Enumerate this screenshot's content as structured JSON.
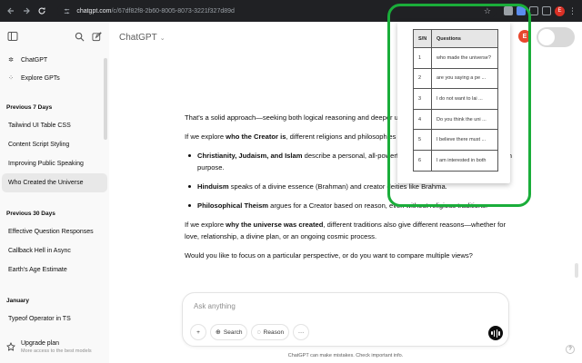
{
  "browser": {
    "url_host": "chatgpt.com",
    "url_path": "/c/67df82f8-2b60-8005-8073-3221f327d89d",
    "profile_letter": "E"
  },
  "sidebar": {
    "top_items": [
      {
        "label": "ChatGPT",
        "icon": "chatgpt-logo-icon"
      },
      {
        "label": "Explore GPTs",
        "icon": "grid-icon"
      }
    ],
    "sections": [
      {
        "title": "Previous 7 Days",
        "items": [
          "Tailwind UI Table CSS",
          "Content Script Styling",
          "Improving Public Speaking",
          "Who Created the Universe"
        ]
      },
      {
        "title": "Previous 30 Days",
        "items": [
          "Effective Question Responses",
          "Callback Hell in Async",
          "Earth's Age Estimate"
        ]
      },
      {
        "title": "January",
        "items": [
          "Typeof Operator in TS"
        ]
      }
    ],
    "selected_item": "Who Created the Universe",
    "upgrade": {
      "title": "Upgrade plan",
      "subtitle": "More access to the best models"
    }
  },
  "header": {
    "title": "ChatGPT",
    "avatar_letter": "E"
  },
  "chat": {
    "p1": "That's a solid approach—seeking both logical reasoning and deeper understanding.",
    "p2_pre": "If we explore ",
    "p2_bold": "who the Creator is",
    "p2_post": ", different religions and philosophies provide different answers:",
    "bullets": [
      {
        "bold": "Christianity, Judaism, and Islam",
        "text": " describe a personal, all-powerful God who created the universe with purpose."
      },
      {
        "bold": "Hinduism",
        "text": " speaks of a divine essence (Brahman) and creator deities like Brahma."
      },
      {
        "bold": "Philosophical Theism",
        "text": " argues for a Creator based on reason, even without religious traditions."
      }
    ],
    "p3_pre": "If we explore ",
    "p3_bold": "why the universe was created",
    "p3_post": ", different traditions also give different reasons—whether for love, relationship, a divine plan, or an ongoing cosmic process.",
    "p4": "Would you like to focus on a particular perspective, or do you want to compare multiple views?"
  },
  "composer": {
    "placeholder": "Ask anything",
    "search_label": "Search",
    "reason_label": "Reason",
    "more_label": "···"
  },
  "disclaimer": "ChatGPT can make mistakes. Check important info.",
  "popup": {
    "headers": [
      "S/N",
      "Questions"
    ],
    "rows": [
      [
        "1",
        "who made the universe?"
      ],
      [
        "2",
        "are you saying a pe ..."
      ],
      [
        "3",
        "I do not want to lai ..."
      ],
      [
        "4",
        "Do you think the uni ..."
      ],
      [
        "5",
        "I believe there must ..."
      ],
      [
        "6",
        "I am interested in both"
      ]
    ]
  },
  "colors": {
    "highlight": "#1aad3a",
    "avatar": "#e8472d"
  }
}
